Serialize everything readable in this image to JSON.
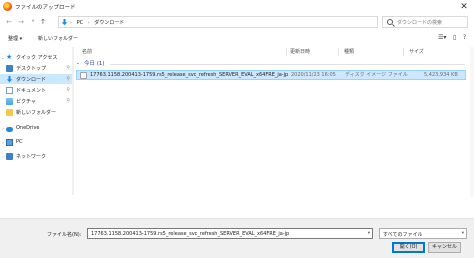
{
  "window": {
    "title": "ファイルのアップロード",
    "close_glyph": "✕"
  },
  "address_bar": {
    "crumbs": [
      "PC",
      "ダウンロード"
    ],
    "separator": "›",
    "search_placeholder": "ダウンロードの検索"
  },
  "toolbar": {
    "organize": "整理 ▾",
    "new_folder": "新しいフォルダー"
  },
  "sidebar": {
    "items": [
      {
        "label": "クイック アクセス",
        "icon": "star-icon",
        "pinned": false
      },
      {
        "label": "デスクトップ",
        "icon": "desktop-icon",
        "pinned": true
      },
      {
        "label": "ダウンロード",
        "icon": "download-icon",
        "pinned": true,
        "selected": true
      },
      {
        "label": "ドキュメント",
        "icon": "document-icon",
        "pinned": true
      },
      {
        "label": "ピクチャ",
        "icon": "picture-icon",
        "pinned": true
      },
      {
        "label": "新しいフォルダー",
        "icon": "folder-icon",
        "pinned": false
      },
      {
        "label": "OneDrive",
        "icon": "cloud-icon",
        "pinned": false
      },
      {
        "label": "PC",
        "icon": "pc-icon",
        "pinned": false
      },
      {
        "label": "ネットワーク",
        "icon": "network-icon",
        "pinned": false
      }
    ]
  },
  "file_list": {
    "columns": {
      "name": "名前",
      "date": "更新日時",
      "type": "種類",
      "size": "サイズ"
    },
    "group_label": "今日 (1)",
    "rows": [
      {
        "name": "17763.1158.200413-1759.rs5_release_svc_refresh_SERVER_EVAL_x64FRE_ja-jp",
        "date": "2020/11/23 16:05",
        "type": "ディスク イメージ ファイル",
        "size": "5,423,934 KB"
      }
    ]
  },
  "bottom": {
    "filename_label": "ファイル名(N):",
    "filename_value": "17763.1158.200413-1759.rs5_release_svc_refresh_SERVER_EVAL_x64FRE_ja-jp",
    "filetype_value": "すべてのファイル",
    "open_button": "開く(O)",
    "cancel_button": "キャンセル"
  },
  "colors": {
    "selection": "#cce8ff",
    "selection_border": "#99d1ff",
    "accent": "#0078d7"
  }
}
